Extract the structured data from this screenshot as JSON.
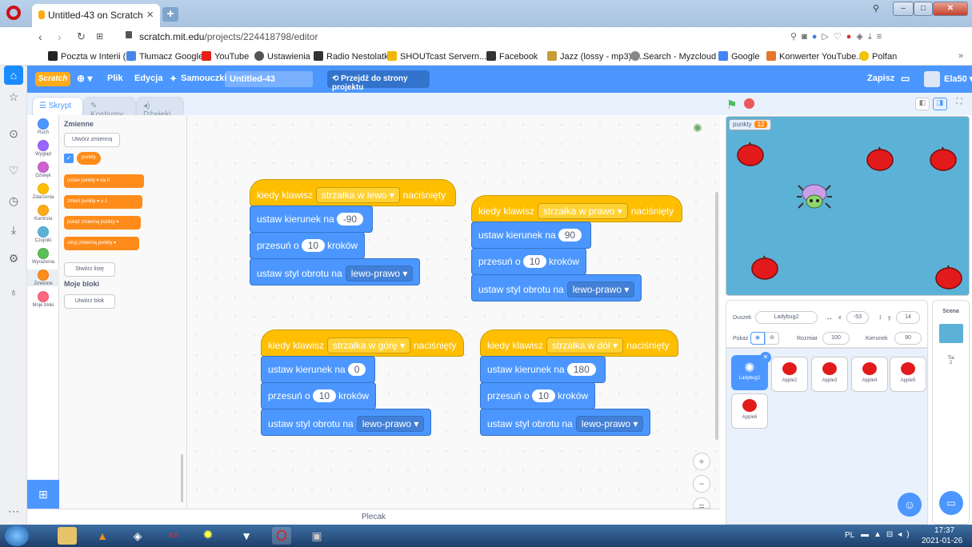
{
  "browser": {
    "tab_title": "Untitled-43 on Scratch",
    "tab_close": "×",
    "new_tab": "+",
    "url_domain": "scratch.mit.edu",
    "url_path": "/projects/224418798/editor",
    "bookmarks": [
      "Poczta w Interii (1)",
      "Tłumacz Google",
      "YouTube",
      "Ustawienia",
      "Radio Nestolatki",
      "SHOUTcast Servern...",
      "Facebook",
      "Jazz (lossy - mp3) -...",
      "Search - Myzcloud",
      "Google",
      "Konwerter YouTube...",
      "Polfan"
    ],
    "more": "»"
  },
  "menubar": {
    "logo": "Scratch",
    "file": "Plik",
    "edit": "Edycja",
    "tutorials": "Samouczki",
    "project_title": "Untitled-43",
    "project_page": "Przejdź do strony projektu",
    "save": "Zapisz",
    "user": "Ela50"
  },
  "tabs": {
    "code": "Skrypt",
    "costumes": "Kostiumy",
    "sounds": "Dźwięki"
  },
  "categories": [
    {
      "label": "Ruch",
      "color": "#4c97ff"
    },
    {
      "label": "Wygląd",
      "color": "#9966ff"
    },
    {
      "label": "Dźwięk",
      "color": "#cf63cf"
    },
    {
      "label": "Zdarzenia",
      "color": "#ffbf00"
    },
    {
      "label": "Kontrola",
      "color": "#ffab19"
    },
    {
      "label": "Czujniki",
      "color": "#5cb1d6"
    },
    {
      "label": "Wyrażenia",
      "color": "#59c059"
    },
    {
      "label": "Zmienne",
      "color": "#ff8c1a"
    },
    {
      "label": "Moje bloki",
      "color": "#ff6680"
    }
  ],
  "palette": {
    "variables_header": "Zmienne",
    "make_variable": "Utwórz zmienną",
    "var_name": "punkty",
    "set_block": "ustaw  punkty ▾  na  0",
    "change_block": "zmień  punkty ▾  o  1",
    "show_block": "pokaż zmienną  punkty ▾",
    "hide_block": "ukryj zmienną  punkty ▾",
    "make_list": "Stwórz listę",
    "myblocks_header": "Moje bloki",
    "make_block": "Utwórz blok"
  },
  "scripts": [
    {
      "hat_pre": "kiedy klawisz",
      "key": "strzałka w lewo ▾",
      "hat_post": "naciśnięty",
      "dir_label": "ustaw kierunek na",
      "dir": "-90",
      "move_pre": "przesuń o",
      "steps": "10",
      "move_post": "kroków",
      "style_label": "ustaw styl obrotu na",
      "style": "lewo-prawo ▾"
    },
    {
      "hat_pre": "kiedy klawisz",
      "key": "strzałka w prawo ▾",
      "hat_post": "naciśnięty",
      "dir_label": "ustaw kierunek na",
      "dir": "90",
      "move_pre": "przesuń o",
      "steps": "10",
      "move_post": "kroków",
      "style_label": "ustaw styl obrotu na",
      "style": "lewo-prawo ▾"
    },
    {
      "hat_pre": "kiedy klawisz",
      "key": "strzałka w górę ▾",
      "hat_post": "naciśnięty",
      "dir_label": "ustaw kierunek na",
      "dir": "0",
      "move_pre": "przesuń o",
      "steps": "10",
      "move_post": "kroków",
      "style_label": "ustaw styl obrotu na",
      "style": "lewo-prawo ▾"
    },
    {
      "hat_pre": "kiedy klawisz",
      "key": "strzałka w dół ▾",
      "hat_post": "naciśnięty",
      "dir_label": "ustaw kierunek na",
      "dir": "180",
      "move_pre": "przesuń o",
      "steps": "10",
      "move_post": "kroków",
      "style_label": "ustaw styl obrotu na",
      "style": "lewo-prawo ▾"
    }
  ],
  "zoom": {
    "in": "+",
    "out": "−",
    "reset": "="
  },
  "backpack": "Plecak",
  "stage": {
    "monitor_label": "punkty",
    "monitor_value": "12"
  },
  "sprite_info": {
    "sprite_label": "Duszek",
    "sprite_name": "Ladybug2",
    "x_label": "x",
    "x_value": "-53",
    "y_label": "y",
    "y_value": "14",
    "show_label": "Pokaż",
    "size_label": "Rozmiar",
    "size_value": "100",
    "direction_label": "Kierunek",
    "direction_value": "90"
  },
  "sprites": [
    "Ladybug2",
    "Apple2",
    "Apple3",
    "Apple4",
    "Apple5",
    "Apple6"
  ],
  "stage_panel": {
    "label": "Scena",
    "backdrops_label": "Tła",
    "backdrops_count": "2"
  },
  "taskbar": {
    "lang": "PL",
    "time": "17:37",
    "date": "2021-01-26"
  }
}
